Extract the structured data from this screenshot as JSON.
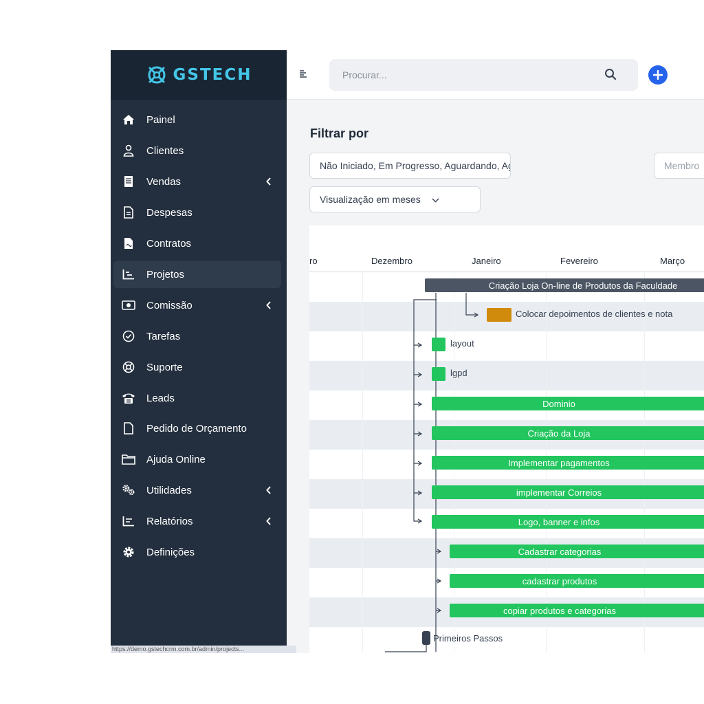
{
  "brand": {
    "name": "GSTECH",
    "accent": "#43c6e8"
  },
  "sidebar": {
    "items": [
      {
        "label": "Painel",
        "icon": "home-icon",
        "submenu": false,
        "active": false
      },
      {
        "label": "Clientes",
        "icon": "user-icon",
        "submenu": false,
        "active": false
      },
      {
        "label": "Vendas",
        "icon": "receipt-icon",
        "submenu": true,
        "active": false
      },
      {
        "label": "Despesas",
        "icon": "document-icon",
        "submenu": false,
        "active": false
      },
      {
        "label": "Contratos",
        "icon": "contract-icon",
        "submenu": false,
        "active": false
      },
      {
        "label": "Projetos",
        "icon": "chart-icon",
        "submenu": false,
        "active": true
      },
      {
        "label": "Comissão",
        "icon": "money-icon",
        "submenu": true,
        "active": false
      },
      {
        "label": "Tarefas",
        "icon": "check-circle-icon",
        "submenu": false,
        "active": false
      },
      {
        "label": "Suporte",
        "icon": "lifebuoy-icon",
        "submenu": false,
        "active": false
      },
      {
        "label": "Leads",
        "icon": "phone-icon",
        "submenu": false,
        "active": false
      },
      {
        "label": "Pedido de Orçamento",
        "icon": "file-icon",
        "submenu": false,
        "active": false
      },
      {
        "label": "Ajuda Online",
        "icon": "folder-icon",
        "submenu": false,
        "active": false
      },
      {
        "label": "Utilidades",
        "icon": "cogs-icon",
        "submenu": true,
        "active": false
      },
      {
        "label": "Relatórios",
        "icon": "reports-icon",
        "submenu": true,
        "active": false
      },
      {
        "label": "Definições",
        "icon": "gear-icon",
        "submenu": false,
        "active": false
      }
    ],
    "status_url": "https://demo.gstechcrm.com.br/admin/projects..."
  },
  "topbar": {
    "search_placeholder": "Procurar..."
  },
  "filters": {
    "title": "Filtrar por",
    "status_value": "Não Iniciado, Em Progresso, Aguardando, Aguardando Cliente",
    "members_placeholder": "Membro",
    "view_value": "Visualização em meses"
  },
  "gantt": {
    "months": [
      "mbro",
      "Dezembro",
      "Janeiro",
      "Fevereiro",
      "Março"
    ],
    "tasks": [
      {
        "name": "Criação Loja On-line de Produtos da Faculdade",
        "type": "summary"
      },
      {
        "name": "Colocar depoimentos de clientes e nota",
        "type": "orange"
      },
      {
        "name": "layout",
        "type": "milestone"
      },
      {
        "name": "lgpd",
        "type": "milestone"
      },
      {
        "name": "Dominio",
        "type": "task"
      },
      {
        "name": "Criação da Loja",
        "type": "task"
      },
      {
        "name": "Implementar pagamentos",
        "type": "task"
      },
      {
        "name": "implementar Correios",
        "type": "task"
      },
      {
        "name": "Logo, banner e infos",
        "type": "task"
      },
      {
        "name": "Cadastrar categorias",
        "type": "task"
      },
      {
        "name": "cadastrar produtos",
        "type": "task"
      },
      {
        "name": "copiar produtos e categorias",
        "type": "task"
      },
      {
        "name": "Primeiros Passos",
        "type": "dark"
      }
    ],
    "colors": {
      "task": "#22c55e",
      "summary": "#4b5563",
      "orange": "#d08a0c",
      "dark": "#374151"
    }
  }
}
